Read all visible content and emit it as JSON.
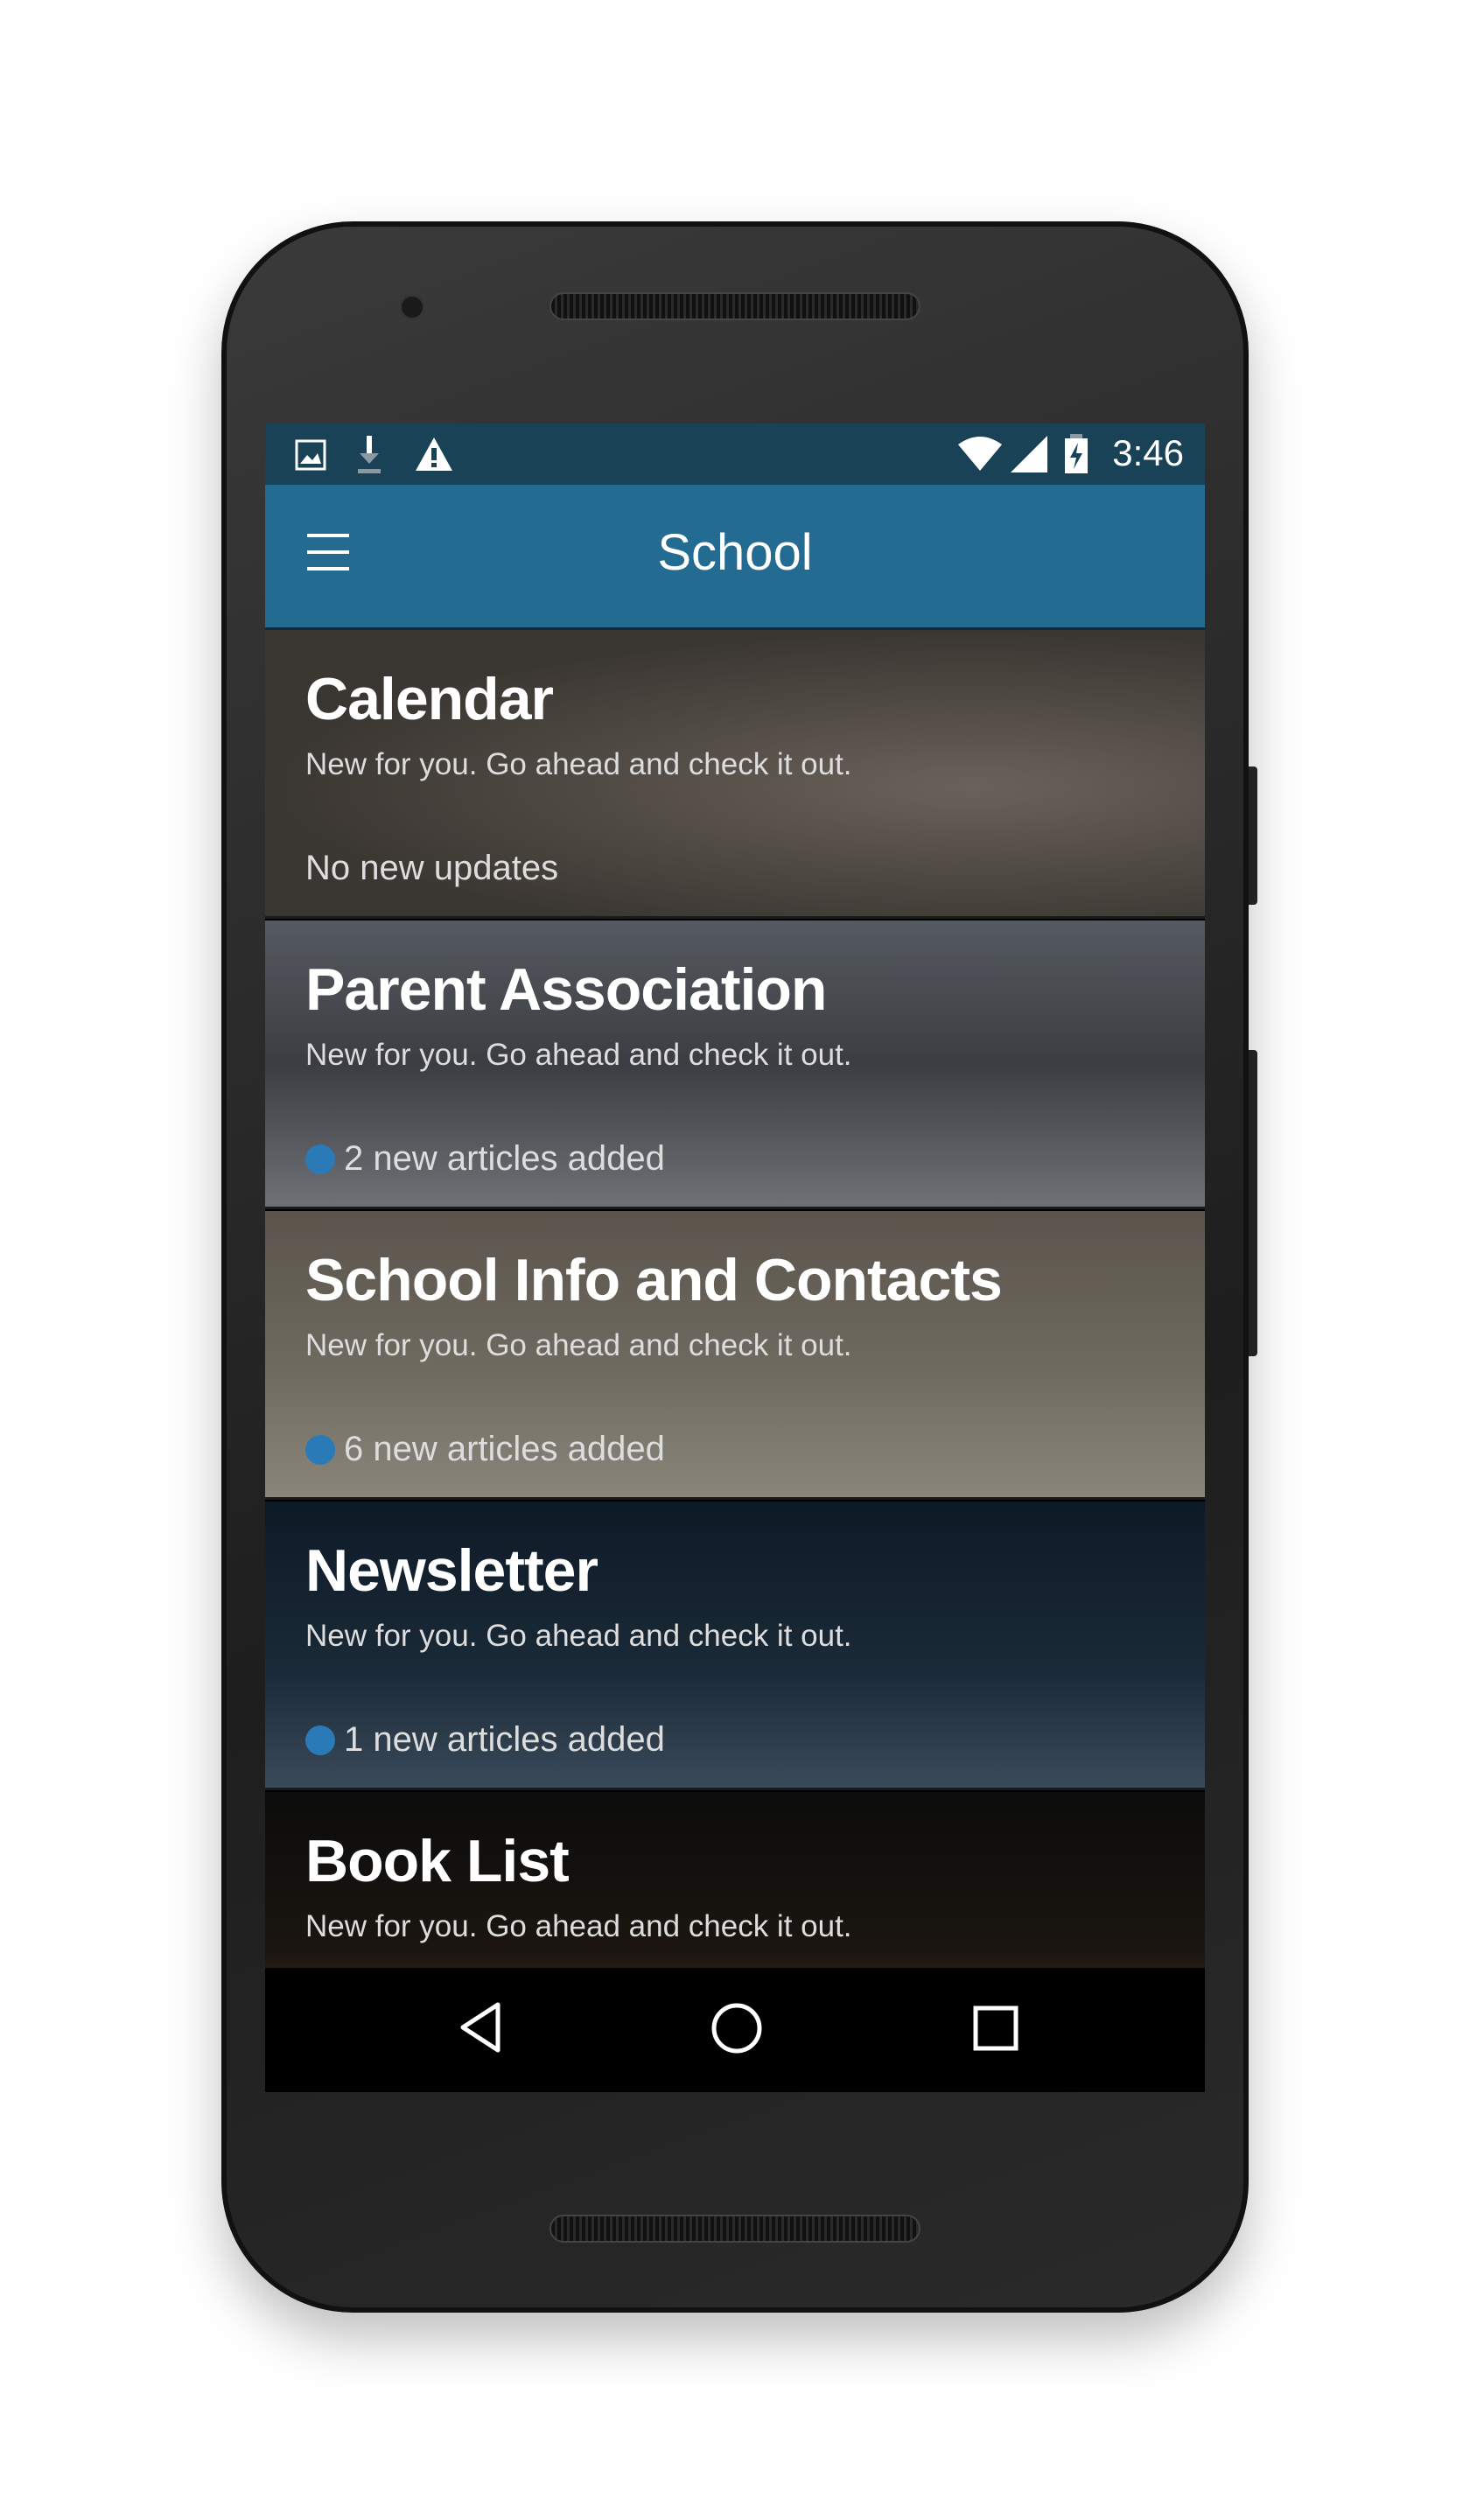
{
  "status_bar": {
    "time": "3:46",
    "left_icons": [
      "image-icon",
      "download-icon",
      "warning-icon"
    ],
    "right_icons": [
      "wifi-icon",
      "signal-icon",
      "battery-charging-icon"
    ]
  },
  "app_bar": {
    "title": "School",
    "menu_icon": "hamburger-menu-icon",
    "color": "#236b91"
  },
  "accent": {
    "badge_dot": "#2a7ab8"
  },
  "cards": [
    {
      "title": "Calendar",
      "subtitle": "New for you. Go ahead and check it out.",
      "status": "No new updates",
      "has_dot": false
    },
    {
      "title": "Parent Association",
      "subtitle": "New for you. Go ahead and check it out.",
      "status": "2 new articles added",
      "has_dot": true
    },
    {
      "title": "School Info and Contacts",
      "subtitle": "New for you. Go ahead and check it out.",
      "status": "6 new articles added",
      "has_dot": true
    },
    {
      "title": "Newsletter",
      "subtitle": "New for you. Go ahead and check it out.",
      "status": "1 new articles added",
      "has_dot": true
    },
    {
      "title": "Book List",
      "subtitle": "New for you. Go ahead and check it out.",
      "status": "",
      "has_dot": false
    }
  ],
  "nav_bar": {
    "icons": [
      "back-icon",
      "home-icon",
      "recents-icon"
    ]
  }
}
